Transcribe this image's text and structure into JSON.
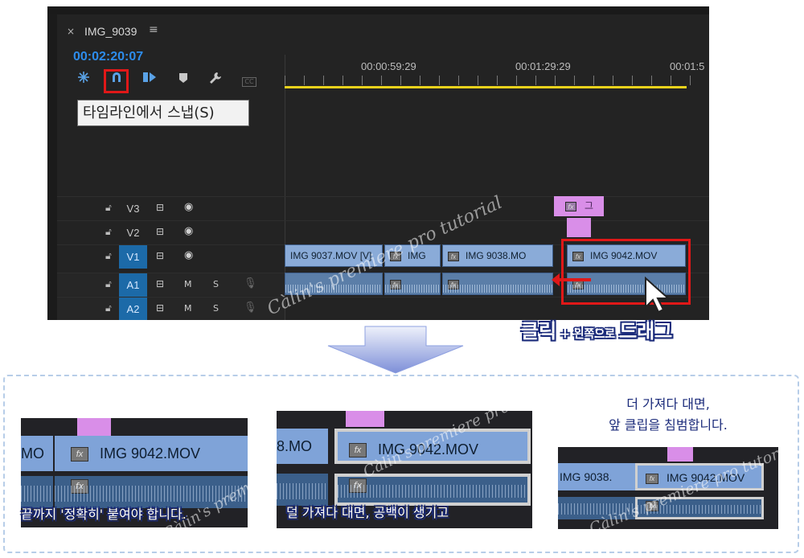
{
  "panel": {
    "close_glyph": "×",
    "sequence_name": "IMG_9039",
    "menu_glyph": "≡",
    "timecode": "00:02:20:07",
    "tooltip": "타임라인에서 스냅(S)",
    "ruler": [
      "00:00:59:29",
      "00:01:29:29",
      "00:01:5"
    ],
    "tools": [
      "nest-icon",
      "snap-icon",
      "linked-selection-icon",
      "marker-icon",
      "wrench-icon",
      "captions-icon"
    ],
    "captions_label": "CC"
  },
  "tracks": [
    {
      "name": "V3",
      "type": "video",
      "active": false
    },
    {
      "name": "V2",
      "type": "video",
      "active": false
    },
    {
      "name": "V1",
      "type": "video",
      "active": true
    },
    {
      "name": "A1",
      "type": "audio",
      "active": true,
      "m": "M",
      "s": "S"
    },
    {
      "name": "A2",
      "type": "audio",
      "active": true,
      "m": "M",
      "s": "S"
    }
  ],
  "clips": {
    "c1": "IMG  9037.MOV [V]",
    "c2": "IMG",
    "c3": "IMG  9038.MO",
    "c4": "IMG  9042.MOV",
    "pink_label": "그"
  },
  "fx_label": "fx",
  "drag_caption": {
    "a": "클릭",
    "plus": " + ",
    "b": "왼쪽으로 ",
    "c": "드래그"
  },
  "watermark": "Càlin's premiere pro tutorial",
  "bottom": {
    "s1": {
      "left_clip": "MO",
      "clip": "IMG  9042.MOV",
      "caption": "끝까지 '정확히' 붙여야 합니다."
    },
    "s2": {
      "left_clip": "8.MO",
      "clip": "IMG  9042.MOV",
      "caption": "덜 가져다 대면, 공백이 생기고"
    },
    "s3": {
      "left_clip": "IMG  9038.",
      "clip": "IMG  9042.MOV",
      "caption_line1": "더 가져다 대면,",
      "caption_line2": "앞 클립을 침범합니다."
    }
  },
  "colors": {
    "accent": "#2d8ceb",
    "highlight": "#e01818",
    "clip": "#8aabd8",
    "pink": "#d98ee8"
  }
}
